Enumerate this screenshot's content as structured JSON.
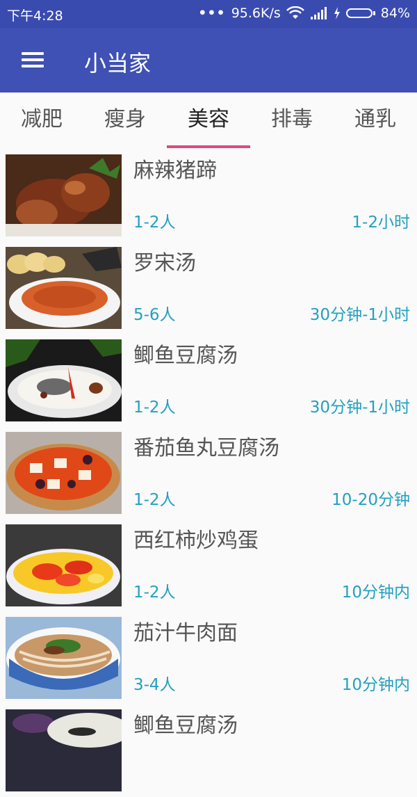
{
  "status": {
    "time": "下午4:28",
    "dots": "•••",
    "speed": "95.6K/s",
    "battery": "84%",
    "battery_level": 0.84
  },
  "appbar": {
    "title": "小当家"
  },
  "tabs": [
    {
      "label": "减肥",
      "active": false
    },
    {
      "label": "瘦身",
      "active": false
    },
    {
      "label": "美容",
      "active": true
    },
    {
      "label": "排毒",
      "active": false
    },
    {
      "label": "通乳",
      "active": false
    }
  ],
  "recipes": [
    {
      "name": "麻辣猪蹄",
      "people": "1-2人",
      "time": "1-2小时"
    },
    {
      "name": "罗宋汤",
      "people": "5-6人",
      "time": "30分钟-1小时"
    },
    {
      "name": "鲫鱼豆腐汤",
      "people": "1-2人",
      "time": "30分钟-1小时"
    },
    {
      "name": "番茄鱼丸豆腐汤",
      "people": "1-2人",
      "time": "10-20分钟"
    },
    {
      "name": "西红柿炒鸡蛋",
      "people": "1-2人",
      "time": "10分钟内"
    },
    {
      "name": "茄汁牛肉面",
      "people": "3-4人",
      "time": "10分钟内"
    },
    {
      "name": "鲫鱼豆腐汤",
      "people": "",
      "time": ""
    }
  ]
}
